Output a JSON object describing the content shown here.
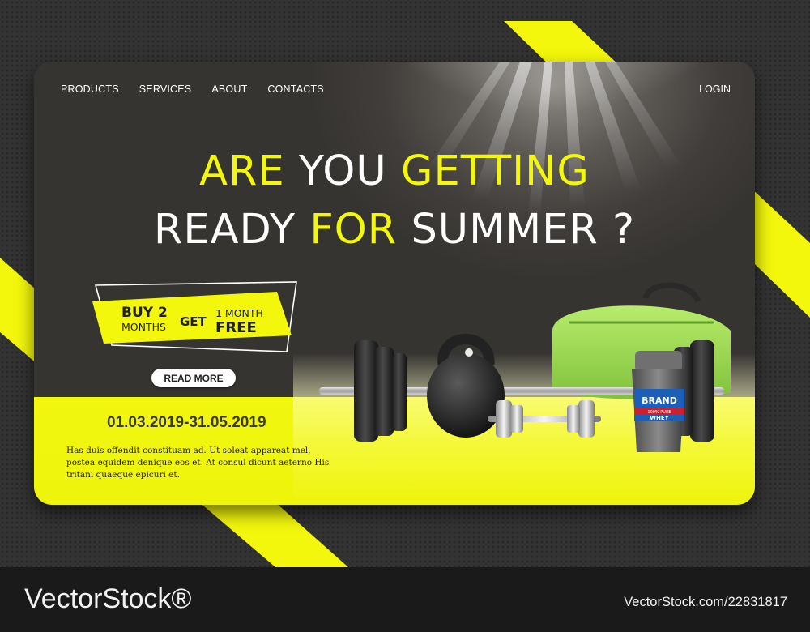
{
  "nav": {
    "items": [
      {
        "label": "PRODUCTS"
      },
      {
        "label": "SERVICES"
      },
      {
        "label": "ABOUT"
      },
      {
        "label": "CONTACTS"
      }
    ],
    "login_label": "LOGIN"
  },
  "hero": {
    "line1": [
      {
        "text": "ARE ",
        "accent": true
      },
      {
        "text": "YOU ",
        "accent": false
      },
      {
        "text": "GETTING",
        "accent": true
      }
    ],
    "line2": [
      {
        "text": "READY ",
        "accent": false
      },
      {
        "text": "FOR ",
        "accent": true
      },
      {
        "text": "SUMMER ?",
        "accent": false
      }
    ]
  },
  "promo": {
    "buy_big": "BUY 2",
    "buy_small": "MONTHS",
    "get": "GET",
    "free_small": "1 MONTH",
    "free_big": "FREE"
  },
  "read_more_label": "READ MORE",
  "dates": "01.03.2019-31.05.2019",
  "description": "Has duis offendit constituam ad. Ut soleat appareat mel, postea equidem denique eos et. At consul dicunt aeterno His tritani quaeque epicuri et.",
  "product": {
    "brand": "BRAND",
    "subtitle": "100% PURE",
    "name": "WHEY"
  },
  "watermark": {
    "logo": "VectorStock®",
    "id": "VectorStock.com/22831817"
  },
  "colors": {
    "accent": "#f2f70c",
    "card_dark": "#3c3a37",
    "background": "#333333",
    "bag_green": "#a6e05a"
  }
}
